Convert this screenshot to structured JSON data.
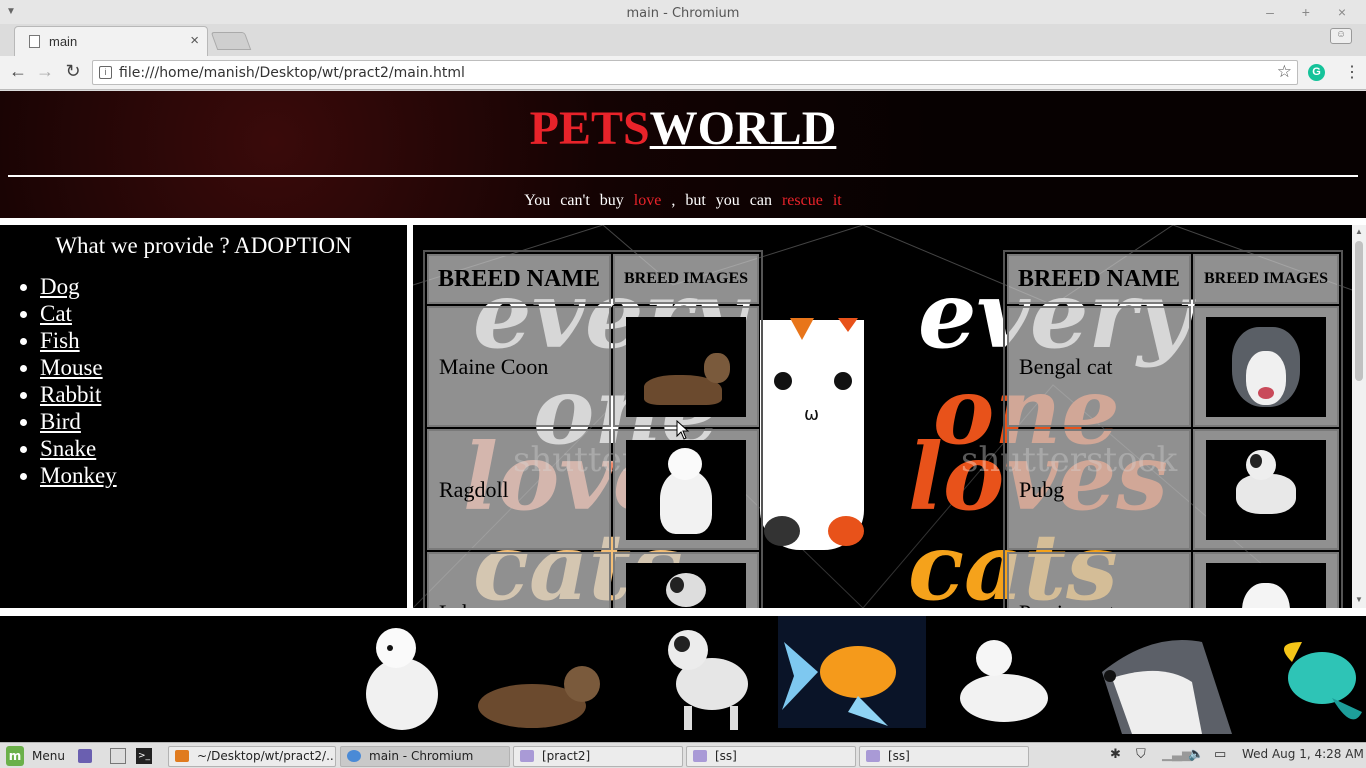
{
  "window": {
    "title": "main - Chromium",
    "controls": "– + ×"
  },
  "tab": {
    "title": "main",
    "close": "×"
  },
  "toolbar": {
    "back": "←",
    "forward": "→",
    "reload": "↻",
    "url": "file:///home/manish/Desktop/wt/pract2/main.html",
    "star": "☆",
    "menu": "⋮",
    "ext": "G"
  },
  "header": {
    "brand_a": "PETS",
    "brand_b": "WORLD",
    "tagline": [
      {
        "text": "You can't buy ",
        "hl": false
      },
      {
        "text": "love",
        "hl": true
      },
      {
        "text": " , but you can ",
        "hl": false
      },
      {
        "text": "rescue it",
        "hl": true
      }
    ]
  },
  "sidebar": {
    "title": "What we provide ? ADOPTION",
    "items": [
      "Dog",
      "Cat",
      "Fish",
      "Mouse",
      "Rabbit",
      "Bird",
      "Snake",
      "Monkey"
    ]
  },
  "background_art": {
    "words": [
      "every",
      "one",
      "loves",
      "cats"
    ],
    "watermark": "shutterstock",
    "colors": {
      "orange": "#e8521a",
      "amber": "#f5a21b",
      "cream": "#ffffff"
    }
  },
  "table_left": {
    "headers": [
      "BREED NAME",
      "BREED IMAGES"
    ],
    "rows": [
      {
        "name": "Maine Coon",
        "image": "maine-coon-cat"
      },
      {
        "name": "Ragdoll",
        "image": "white-fluffy-puppy"
      },
      {
        "name": "Lab",
        "image": "spotted-puppy"
      }
    ]
  },
  "table_right": {
    "headers": [
      "BREED NAME",
      "BREED IMAGES"
    ],
    "rows": [
      {
        "name": "Bengal cat",
        "image": "husky-dog"
      },
      {
        "name": "Pubg",
        "image": "spotted-puppy"
      },
      {
        "name": "Persian cat",
        "image": "white-cat"
      }
    ]
  },
  "gallery": [
    "white-fluffy-puppy",
    "maine-coon-cat",
    "spotted-puppy",
    "goldfish",
    "white-cat",
    "husky-dog",
    "betta-fish"
  ],
  "taskbar": {
    "menu": "Menu",
    "windows": [
      {
        "label": "~/Desktop/wt/pract2/...",
        "active": false
      },
      {
        "label": "main - Chromium",
        "active": true
      },
      {
        "label": "[pract2]",
        "active": false
      },
      {
        "label": "[ss]",
        "active": false
      },
      {
        "label": "[ss]",
        "active": false
      }
    ],
    "clock": "Wed Aug  1,  4:28 AM"
  }
}
